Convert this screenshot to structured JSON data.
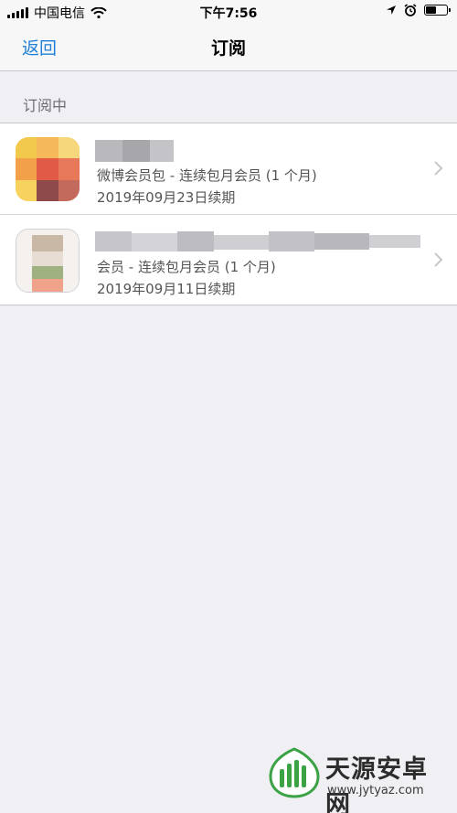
{
  "status_bar": {
    "carrier": "中国电信",
    "time": "下午7:56",
    "battery_level": 0.45,
    "icons": [
      "signal-icon",
      "wifi-icon",
      "location-icon",
      "alarm-icon",
      "battery-icon"
    ]
  },
  "nav": {
    "back_label": "返回",
    "title": "订阅"
  },
  "section": {
    "header": "订阅中"
  },
  "subscriptions": [
    {
      "plan": "微博会员包 - 连续包月会员 (1 个月)",
      "renewal": "2019年09月23日续期",
      "icon_colors": [
        "#f2c94c",
        "#e05a45",
        "#8e4a4a"
      ]
    },
    {
      "plan": "会员 - 连续包月会员 (1 个月)",
      "renewal": "2019年09月11日续期",
      "icon_colors": [
        "#c9b8a6",
        "#9fb081",
        "#f0a28a"
      ]
    }
  ],
  "colors": {
    "accent": "#1f7fd7",
    "background": "#efeff4",
    "secondary_text": "#555555"
  },
  "watermark": {
    "name": "天源安卓网",
    "url": "www.jytyaz.com",
    "accent": "#3ba345"
  }
}
